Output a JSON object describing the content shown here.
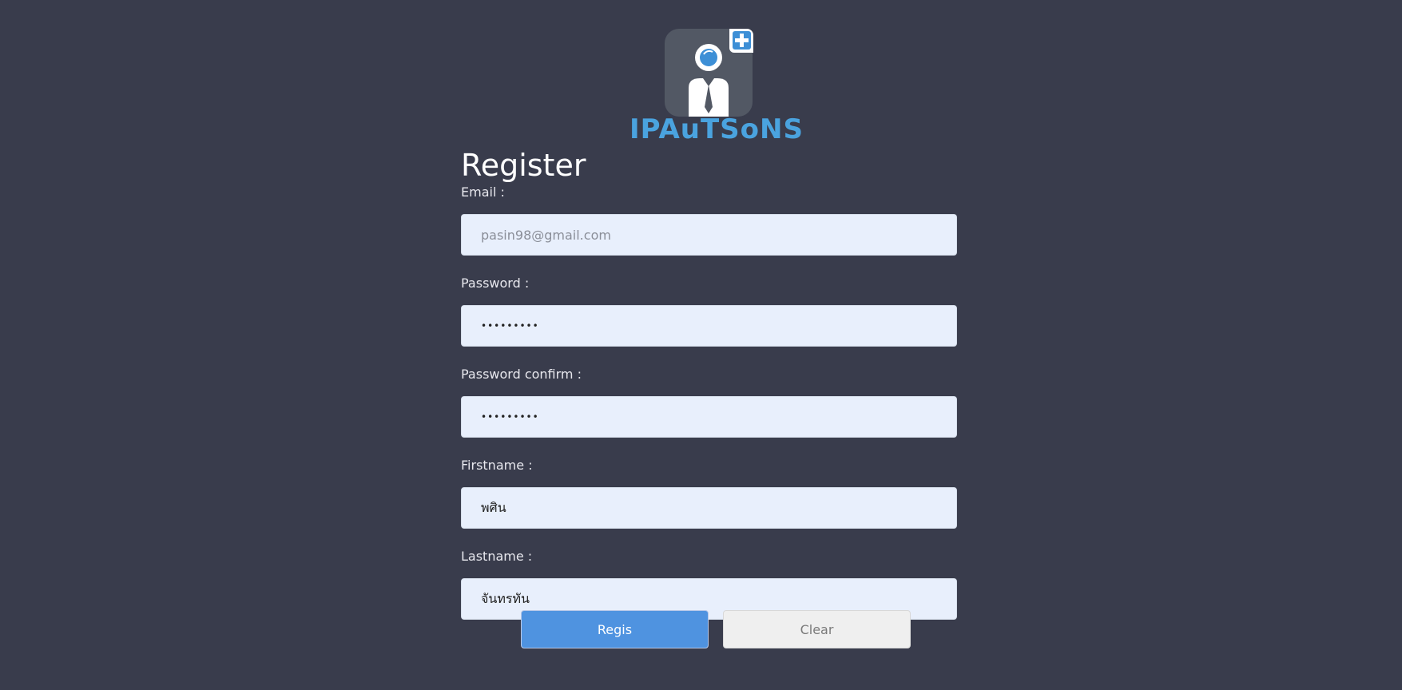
{
  "app": {
    "logo_text": "IPAuTSoNS",
    "brand_color": "#4aa3df",
    "background_color": "#393c4c"
  },
  "form": {
    "title": "Register",
    "fields": [
      {
        "label": "Email :",
        "placeholder": "pasin98@gmail.com",
        "value": "",
        "type": "email"
      },
      {
        "label": "Password :",
        "placeholder": "",
        "value": "•••••••••",
        "type": "password"
      },
      {
        "label": "Password confirm :",
        "placeholder": "",
        "value": "•••••••••",
        "type": "password"
      },
      {
        "label": "Firstname :",
        "placeholder": "",
        "value": "พศิน",
        "type": "text"
      },
      {
        "label": "Lastname :",
        "placeholder": "",
        "value": "จันทรทัน",
        "type": "text"
      }
    ],
    "buttons": {
      "regis_label": "Regis",
      "clear_label": "Clear"
    }
  }
}
